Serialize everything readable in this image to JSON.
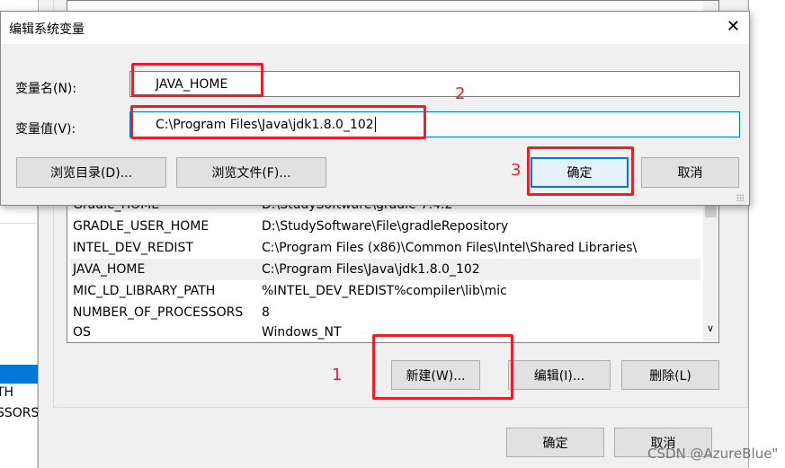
{
  "background_window": {
    "left_list": {
      "items": [
        "TH",
        "SSORS"
      ],
      "selected_index": 0
    },
    "variables": [
      {
        "name": "Gradle_HOME",
        "value": "D:\\StudySoftware\\gradle-7.4.2"
      },
      {
        "name": "GRADLE_USER_HOME",
        "value": "D:\\StudySoftware\\File\\gradleRepository"
      },
      {
        "name": "INTEL_DEV_REDIST",
        "value": "C:\\Program Files (x86)\\Common Files\\Intel\\Shared Libraries\\"
      },
      {
        "name": "JAVA_HOME",
        "value": "C:\\Program Files\\Java\\jdk1.8.0_102"
      },
      {
        "name": "MIC_LD_LIBRARY_PATH",
        "value": "%INTEL_DEV_REDIST%compiler\\lib\\mic"
      },
      {
        "name": "NUMBER_OF_PROCESSORS",
        "value": "8"
      },
      {
        "name": "OS",
        "value": "Windows_NT"
      }
    ],
    "new_button": "新建(W)...",
    "edit_button": "编辑(I)...",
    "delete_button": "删除(L)",
    "ok_button": "确定",
    "cancel_button": "取消"
  },
  "dialog": {
    "title": "编辑系统变量",
    "name_label": "变量名(N):",
    "name_value": "JAVA_HOME",
    "value_label": "变量值(V):",
    "value_value": "C:\\Program Files\\Java\\jdk1.8.0_102",
    "browse_dir_button": "浏览目录(D)...",
    "browse_file_button": "浏览文件(F)...",
    "ok_button": "确定",
    "cancel_button": "取消"
  },
  "annotations": [
    "1",
    "2",
    "3"
  ],
  "watermark": "CSDN @AzureBlue\"",
  "colors": {
    "annotation": "#e8202a",
    "focus": "#0078d7",
    "selected": "#0078d7"
  }
}
